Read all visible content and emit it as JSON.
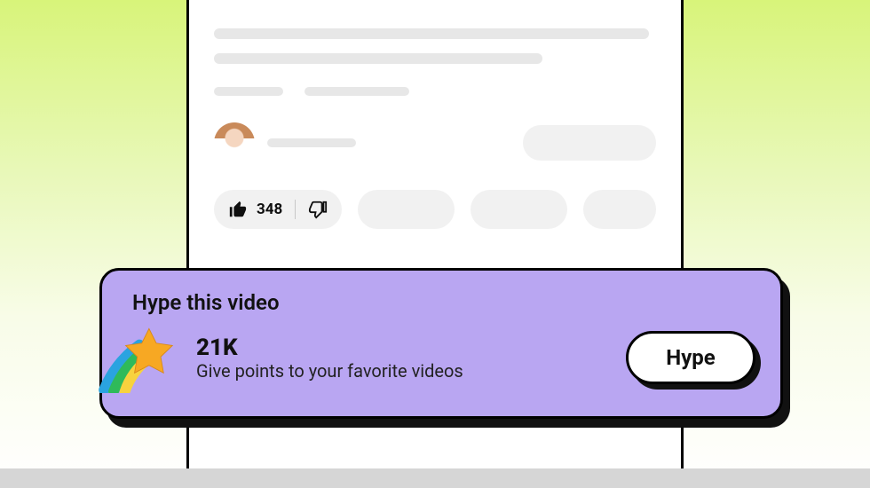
{
  "video": {
    "like_count": "348"
  },
  "hype": {
    "title": "Hype this video",
    "count": "21K",
    "subtitle": "Give points to your favorite videos",
    "button_label": "Hype"
  },
  "colors": {
    "banner_bg": "#b9a6f2",
    "star_fill": "#f7a823",
    "trail_blue": "#2aa3e0",
    "trail_green": "#2fba5a",
    "trail_yellow": "#f7d23e"
  }
}
